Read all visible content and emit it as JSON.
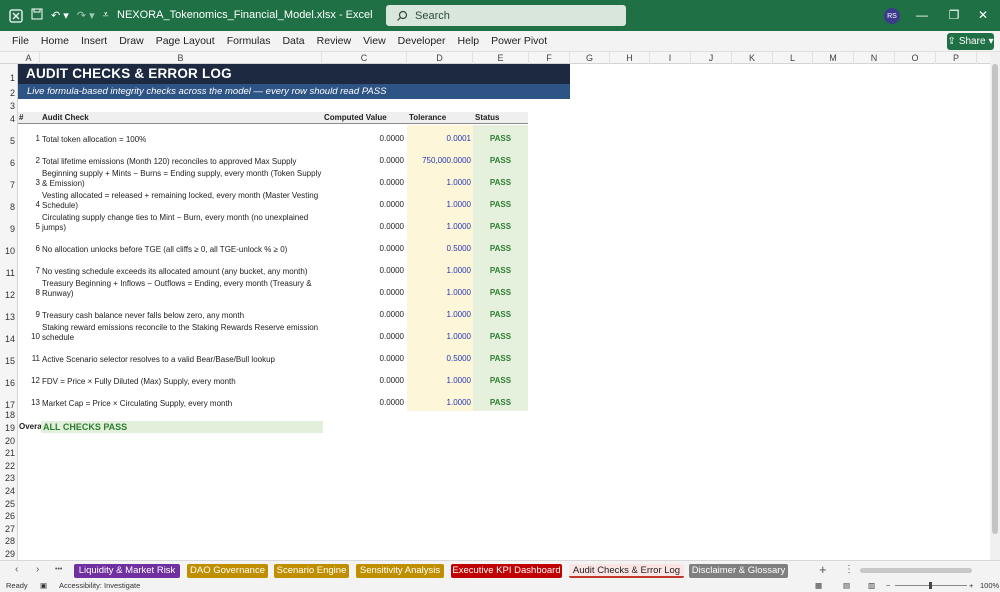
{
  "titlebar": {
    "file_name": "NEXORA_Tokenomics_Financial_Model.xlsx",
    "separator": "-",
    "app_name": "Excel",
    "search_placeholder": "Search",
    "user_initials": "RS"
  },
  "ribbon": {
    "tabs": [
      "File",
      "Home",
      "Insert",
      "Draw",
      "Page Layout",
      "Formulas",
      "Data",
      "Review",
      "View",
      "Developer",
      "Help",
      "Power Pivot"
    ],
    "share_label": "Share"
  },
  "columns": [
    "A",
    "B",
    "C",
    "D",
    "E",
    "F",
    "G",
    "H",
    "I",
    "J",
    "K",
    "L",
    "M",
    "N",
    "O",
    "P"
  ],
  "rows": [
    "1",
    "2",
    "3",
    "4",
    "5",
    "6",
    "7",
    "8",
    "9",
    "10",
    "11",
    "12",
    "13",
    "14",
    "15",
    "16",
    "17",
    "18",
    "19",
    "20",
    "21",
    "22",
    "23",
    "24",
    "25",
    "26",
    "27",
    "28",
    "29"
  ],
  "sheet": {
    "title": "AUDIT CHECKS & ERROR LOG",
    "subtitle": "Live formula-based integrity checks across the model — every row should read PASS",
    "headers": {
      "num": "#",
      "check": "Audit Check",
      "computed": "Computed Value",
      "tolerance": "Tolerance",
      "status": "Status"
    },
    "checks": [
      {
        "num": "1",
        "check": "Total token allocation = 100%",
        "computed": "0.0000",
        "tolerance": "0.0001",
        "status": "PASS"
      },
      {
        "num": "2",
        "check": "Total lifetime emissions (Month 120) reconciles to approved Max Supply",
        "computed": "0.0000",
        "tolerance": "750,000.0000",
        "status": "PASS"
      },
      {
        "num": "3",
        "check": "Beginning supply + Mints − Burns = Ending supply, every month (Token Supply & Emission)",
        "computed": "0.0000",
        "tolerance": "1.0000",
        "status": "PASS"
      },
      {
        "num": "4",
        "check": "Vesting allocated = released + remaining locked, every month (Master Vesting Schedule)",
        "computed": "0.0000",
        "tolerance": "1.0000",
        "status": "PASS"
      },
      {
        "num": "5",
        "check": "Circulating supply change ties to Mint − Burn, every month (no unexplained jumps)",
        "computed": "0.0000",
        "tolerance": "1.0000",
        "status": "PASS"
      },
      {
        "num": "6",
        "check": "No allocation unlocks before TGE (all cliffs ≥ 0, all TGE-unlock % ≥ 0)",
        "computed": "0.0000",
        "tolerance": "0.5000",
        "status": "PASS"
      },
      {
        "num": "7",
        "check": "No vesting schedule exceeds its allocated amount (any bucket, any month)",
        "computed": "0.0000",
        "tolerance": "1.0000",
        "status": "PASS"
      },
      {
        "num": "8",
        "check": "Treasury Beginning + Inflows − Outflows = Ending, every month (Treasury & Runway)",
        "computed": "0.0000",
        "tolerance": "1.0000",
        "status": "PASS"
      },
      {
        "num": "9",
        "check": "Treasury cash balance never falls below zero, any month",
        "computed": "0.0000",
        "tolerance": "1.0000",
        "status": "PASS"
      },
      {
        "num": "10",
        "check": "Staking reward emissions reconcile to the Staking Rewards Reserve emission schedule",
        "computed": "0.0000",
        "tolerance": "1.0000",
        "status": "PASS"
      },
      {
        "num": "11",
        "check": "Active Scenario selector resolves to a valid Bear/Base/Bull lookup",
        "computed": "0.0000",
        "tolerance": "0.5000",
        "status": "PASS"
      },
      {
        "num": "12",
        "check": "FDV = Price × Fully Diluted (Max) Supply, every month",
        "computed": "0.0000",
        "tolerance": "1.0000",
        "status": "PASS"
      },
      {
        "num": "13",
        "check": "Market Cap = Price × Circulating Supply, every month",
        "computed": "0.0000",
        "tolerance": "1.0000",
        "status": "PASS"
      }
    ],
    "overall_label": "Overall",
    "overall_value": "ALL CHECKS PASS"
  },
  "sheet_tabs": [
    {
      "label": "Liquidity & Market Risk",
      "color": "#7030a0"
    },
    {
      "label": "DAO Governance",
      "color": "#bf8f00"
    },
    {
      "label": "Scenario Engine",
      "color": "#bf8f00"
    },
    {
      "label": "Sensitivity Analysis",
      "color": "#bf8f00"
    },
    {
      "label": "Executive KPI Dashboard",
      "color": "#c00000"
    },
    {
      "label": "Audit Checks & Error Log",
      "color": "#c00000",
      "active": true
    },
    {
      "label": "Disclaimer & Glossary",
      "color": "#7f7f7f"
    }
  ],
  "nav": {
    "prev": "‹",
    "next": "›",
    "more": "•••",
    "add": "+",
    "menu": "⋮"
  },
  "statusbar": {
    "ready": "Ready",
    "accessibility": "Accessibility: Investigate",
    "zoom": "100%"
  }
}
